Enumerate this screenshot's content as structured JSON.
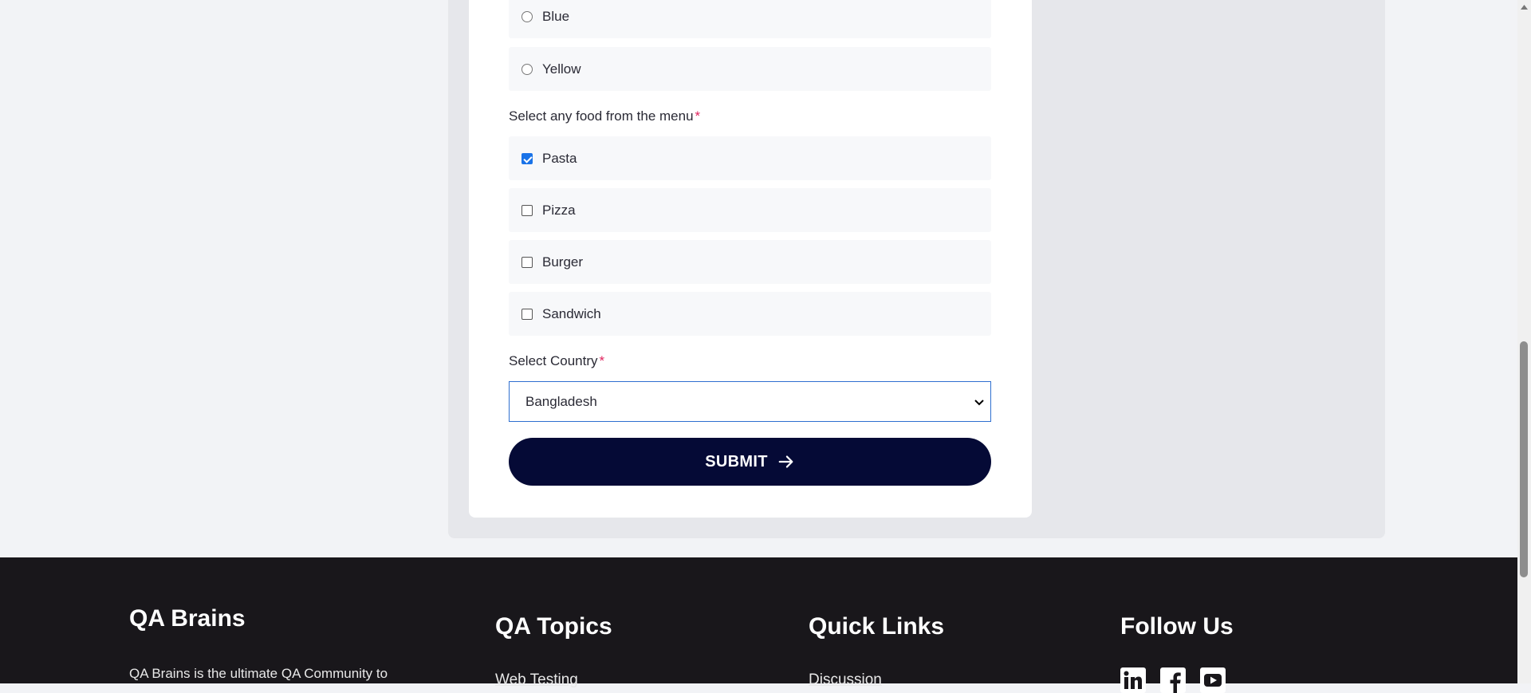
{
  "color_options": [
    {
      "label": "Blue",
      "selected": false
    },
    {
      "label": "Yellow",
      "selected": false
    }
  ],
  "food_section": {
    "label": "Select any food from the menu",
    "required_mark": "*",
    "items": [
      {
        "label": "Pasta",
        "checked": true
      },
      {
        "label": "Pizza",
        "checked": false
      },
      {
        "label": "Burger",
        "checked": false
      },
      {
        "label": "Sandwich",
        "checked": false
      }
    ]
  },
  "country_section": {
    "label": "Select Country",
    "required_mark": "*",
    "selected": "Bangladesh"
  },
  "submit": {
    "label": "SUBMIT",
    "icon": "arrow-right-icon"
  },
  "footer": {
    "brand": "QA Brains",
    "description": "QA Brains is the ultimate QA Community to",
    "qa_topics": {
      "title": "QA Topics",
      "first_link": "Web Testing"
    },
    "quick_links": {
      "title": "Quick Links",
      "first_link": "Discussion"
    },
    "follow_us": {
      "title": "Follow Us",
      "icons": [
        "linkedin-icon",
        "facebook-icon",
        "youtube-icon"
      ]
    }
  },
  "colors": {
    "submit_bg": "#050a36",
    "footer_bg": "#19171b",
    "required": "#e0245e",
    "checkbox_checked": "#1a73e8",
    "select_border": "#2f6fd0"
  }
}
